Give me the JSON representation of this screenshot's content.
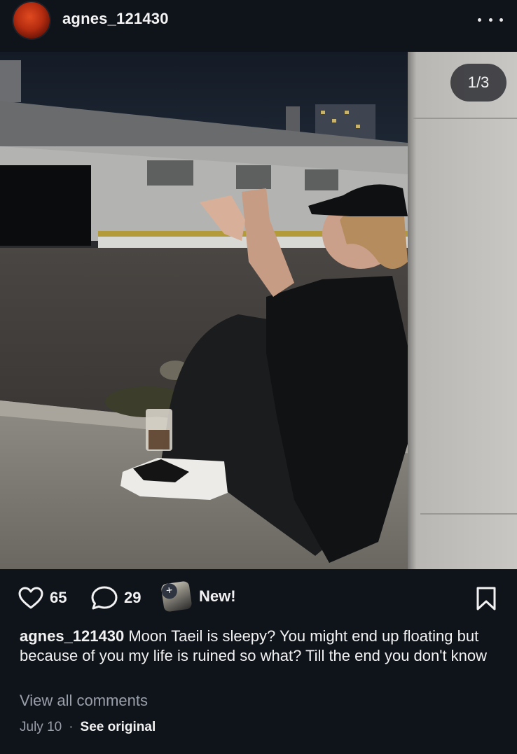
{
  "post": {
    "username": "agnes_121430",
    "image_counter": "1/3",
    "likes": "65",
    "comments": "29",
    "new_label": "New!",
    "caption_user": "agnes_121430",
    "caption_text": " Moon Taeil is sleepy? You might end up floating but because of you my life is ruined so what? Till the end you don't know",
    "view_comments": "View all comments",
    "date": "July 10",
    "separator": "·",
    "see_original": "See original"
  },
  "icons": {
    "more": "more-horizontal-icon",
    "like": "heart-icon",
    "comment": "comment-bubble-icon",
    "bookmark": "bookmark-icon"
  },
  "colors": {
    "background": "#0f131a",
    "text": "#f2f2f2",
    "muted": "#9aa0aa",
    "avatar": "#b42c10"
  }
}
